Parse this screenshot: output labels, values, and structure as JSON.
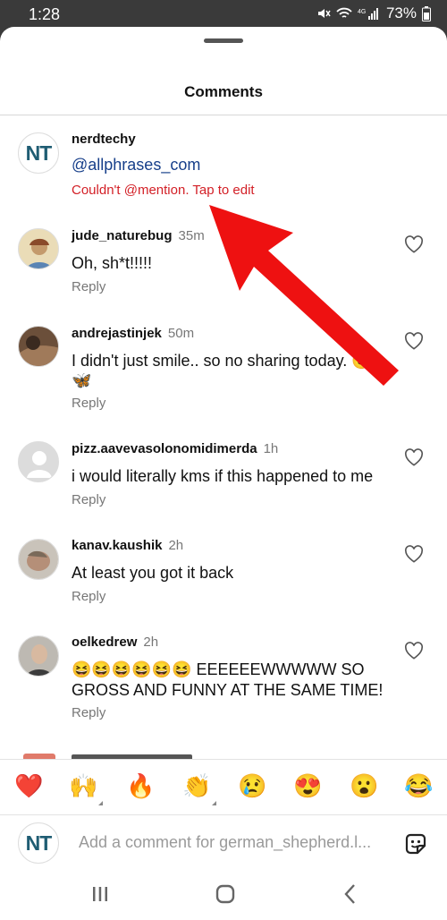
{
  "status_bar": {
    "time": "1:28",
    "battery": "73%"
  },
  "sheet": {
    "title": "Comments"
  },
  "caption": {
    "username": "nerdtechy",
    "avatar_text": "NT",
    "mention": "@allphrases_com",
    "error": "Couldn't @mention. Tap to edit"
  },
  "comments": [
    {
      "username": "jude_naturebug",
      "time": "35m",
      "text": "Oh, sh*t!!!!!",
      "reply": "Reply"
    },
    {
      "username": "andrejastinjek",
      "time": "50m",
      "text": "I didn't just smile.. so no sharing today. 🙂",
      "text2": "🦋",
      "reply": "Reply"
    },
    {
      "username": "pizz.aavevasolonomidimerda",
      "time": "1h",
      "text": "i would literally kms if this happened to me",
      "reply": "Reply"
    },
    {
      "username": "kanav.kaushik",
      "time": "2h",
      "text": "At least you got it back",
      "reply": "Reply"
    },
    {
      "username": "oelkedrew",
      "time": "2h",
      "text": "😆😆😆😆😆😆 EEEEEEWWWWW SO",
      "text2": "GROSS AND FUNNY AT THE SAME TIME!",
      "reply": "Reply"
    }
  ],
  "emoji_bar": [
    "❤️",
    "🙌",
    "🔥",
    "👏",
    "😢",
    "😍",
    "😮",
    "😂"
  ],
  "composer": {
    "avatar_text": "NT",
    "placeholder": "Add a comment for german_shepherd.l..."
  },
  "icons": {
    "heart": "heart-outline-icon",
    "sticker": "sticker-icon",
    "recent_apps": "recent-apps-icon",
    "home": "home-icon",
    "back": "back-icon"
  },
  "colors": {
    "arrow": "#ee1111",
    "mention": "#173f8a",
    "error": "#d32027",
    "brand": "#1f5d73"
  }
}
